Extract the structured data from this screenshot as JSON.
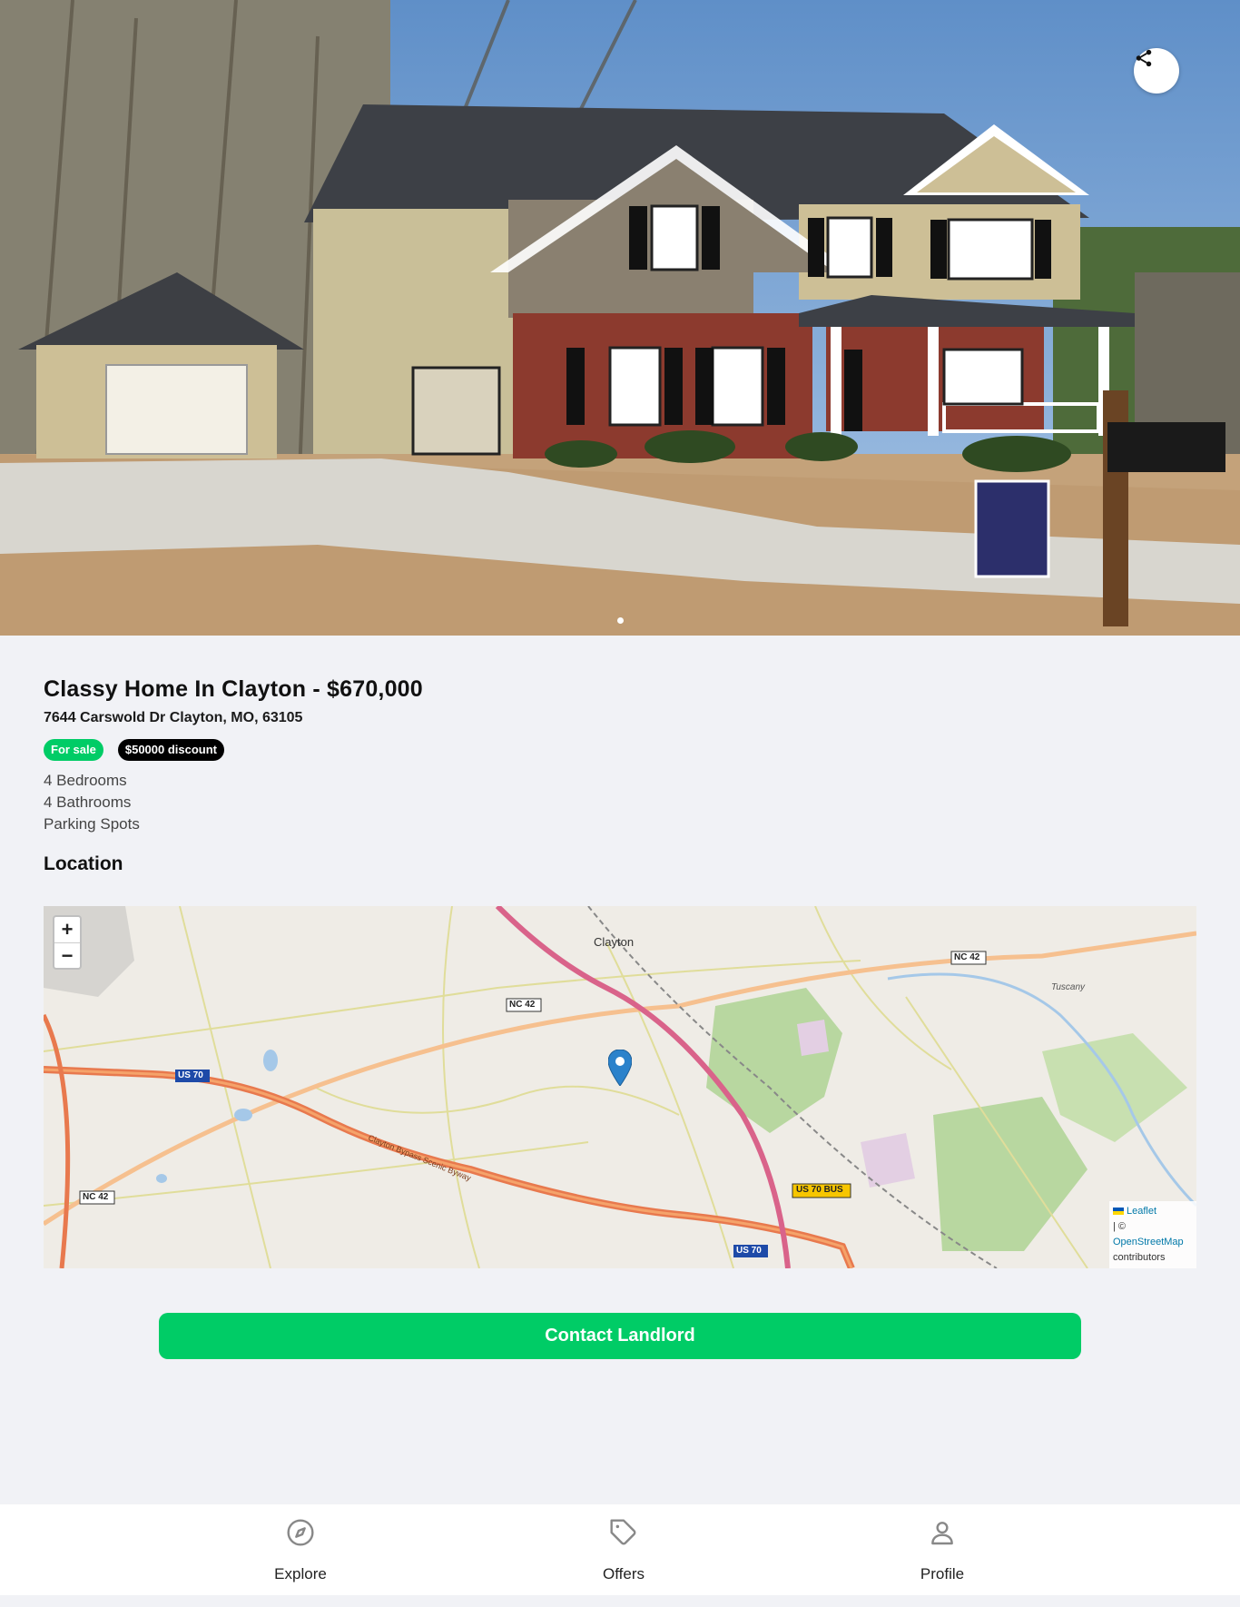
{
  "listing": {
    "title": "Classy Home In Clayton - $670,000",
    "address": "7644 Carswold Dr Clayton, MO, 63105",
    "badges": [
      "For sale",
      "$50000 discount"
    ],
    "features": [
      "4 Bedrooms",
      "4 Bathrooms",
      "Parking Spots"
    ]
  },
  "sections": {
    "location": "Location"
  },
  "map": {
    "zoom_in": "+",
    "zoom_out": "−",
    "labels": {
      "town": "Clayton",
      "tuscany": "Tuscany",
      "nc42_a": "NC 42",
      "nc42_b": "NC 42",
      "nc42_c": "NC 42",
      "us70_a": "US 70",
      "us70_b": "US 70",
      "us70bus": "US 70 BUS",
      "bypass": "Clayton Bypass Scenic Byway"
    },
    "attribution": {
      "leaflet": "Leaflet",
      "sep": "| ©",
      "osm": "OpenStreetMap",
      "contrib": "contributors"
    }
  },
  "contact_label": "Contact Landlord",
  "carousel": {
    "current": 1,
    "total": 1
  },
  "nav": {
    "explore": "Explore",
    "offers": "Offers",
    "profile": "Profile"
  },
  "colors": {
    "accent": "#00cc66",
    "background": "#f1f2f6"
  },
  "icons": {
    "share": "share-icon",
    "explore": "compass-icon",
    "offers": "tag-icon",
    "profile": "user-icon",
    "marker": "map-marker-icon"
  }
}
